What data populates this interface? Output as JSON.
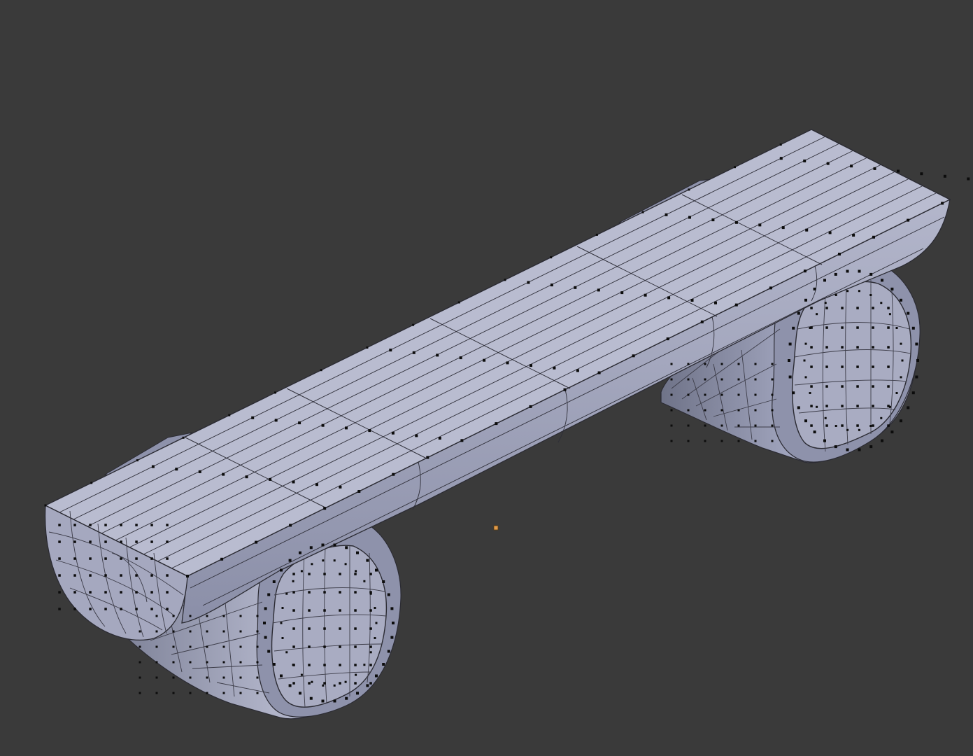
{
  "viewport": {
    "background_color": "#3a3a3a",
    "view_mode": "edit-mode-wireframe-solid"
  },
  "model": {
    "object": "log-bench-mesh",
    "parts": [
      "bench-seat-half-log",
      "left-log-leg",
      "right-log-leg"
    ],
    "colors": {
      "top_face": "#b9bcd0",
      "side_face": "#a2a6c0",
      "side_face_dark": "#8d91aa",
      "end_cap": "#a9acc2",
      "leg_body": "#9ea2bb",
      "leg_shadow": "#7f8399",
      "wire": "#2b2b33",
      "vertex": "#0c0c0c",
      "origin": "#e09a4a"
    }
  }
}
